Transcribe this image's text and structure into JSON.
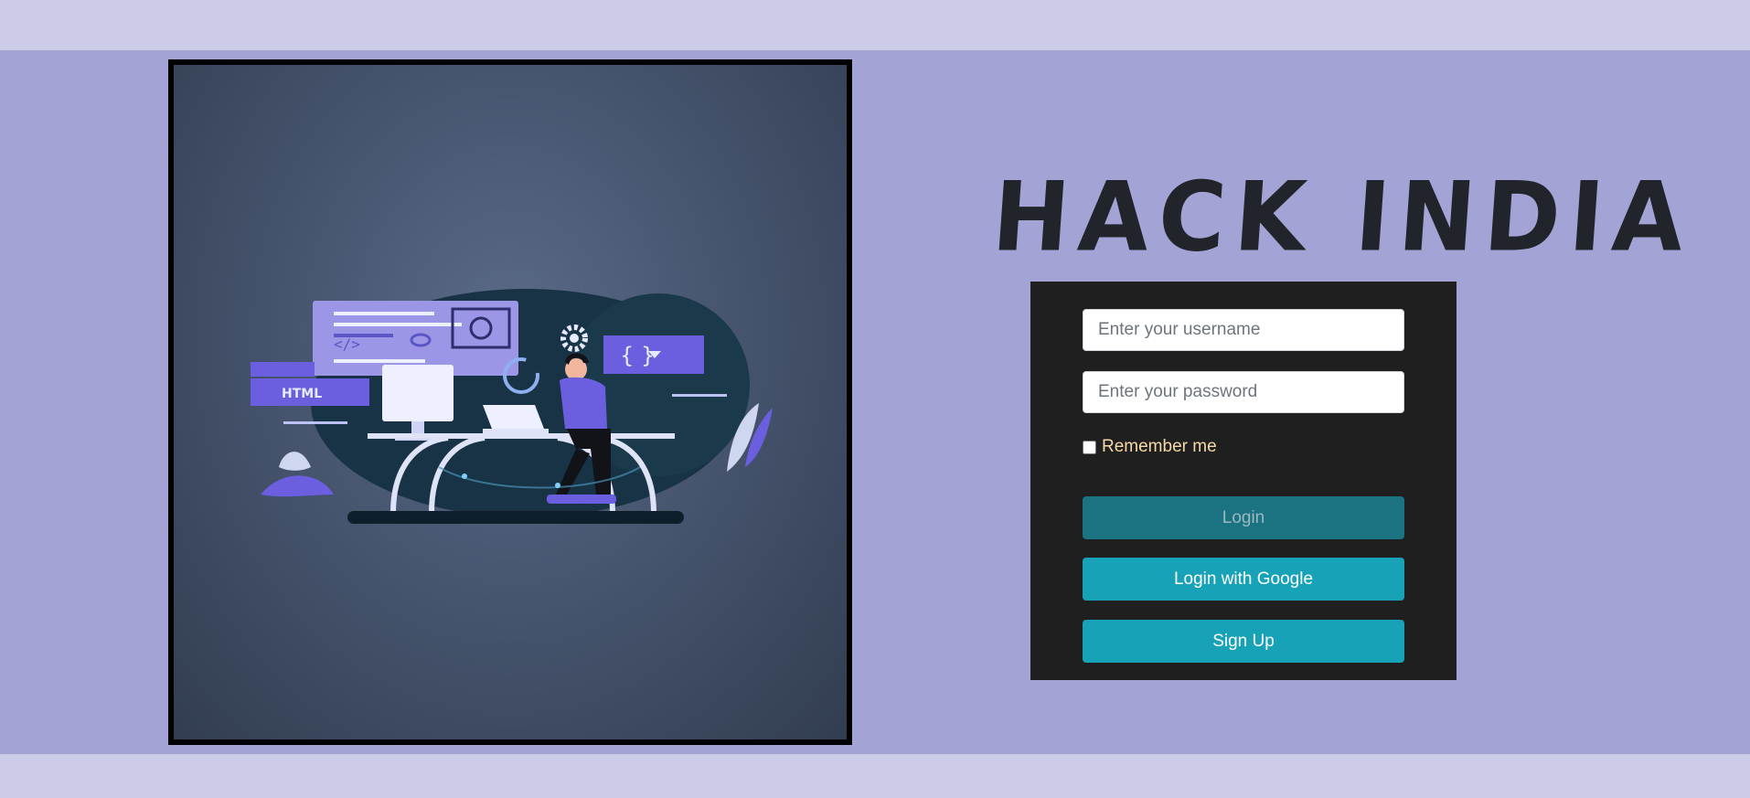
{
  "brand": {
    "title": "HACK INDIA"
  },
  "illustration": {
    "html_tag_text": "HTML",
    "code_tag_text": "</>",
    "braces_text": "{ }"
  },
  "login_form": {
    "username_placeholder": "Enter your username",
    "password_placeholder": "Enter your password",
    "remember_label": "Remember me",
    "login_label": "Login",
    "google_label": "Login with Google",
    "signup_label": "Sign Up"
  },
  "colors": {
    "page_band": "#cccbe8",
    "main_background": "#a4a3d6",
    "card_background": "#1f1f1f",
    "primary_button": "#17a2b8",
    "disabled_button": "#1b7281",
    "remember_text": "#f7d9a7"
  }
}
